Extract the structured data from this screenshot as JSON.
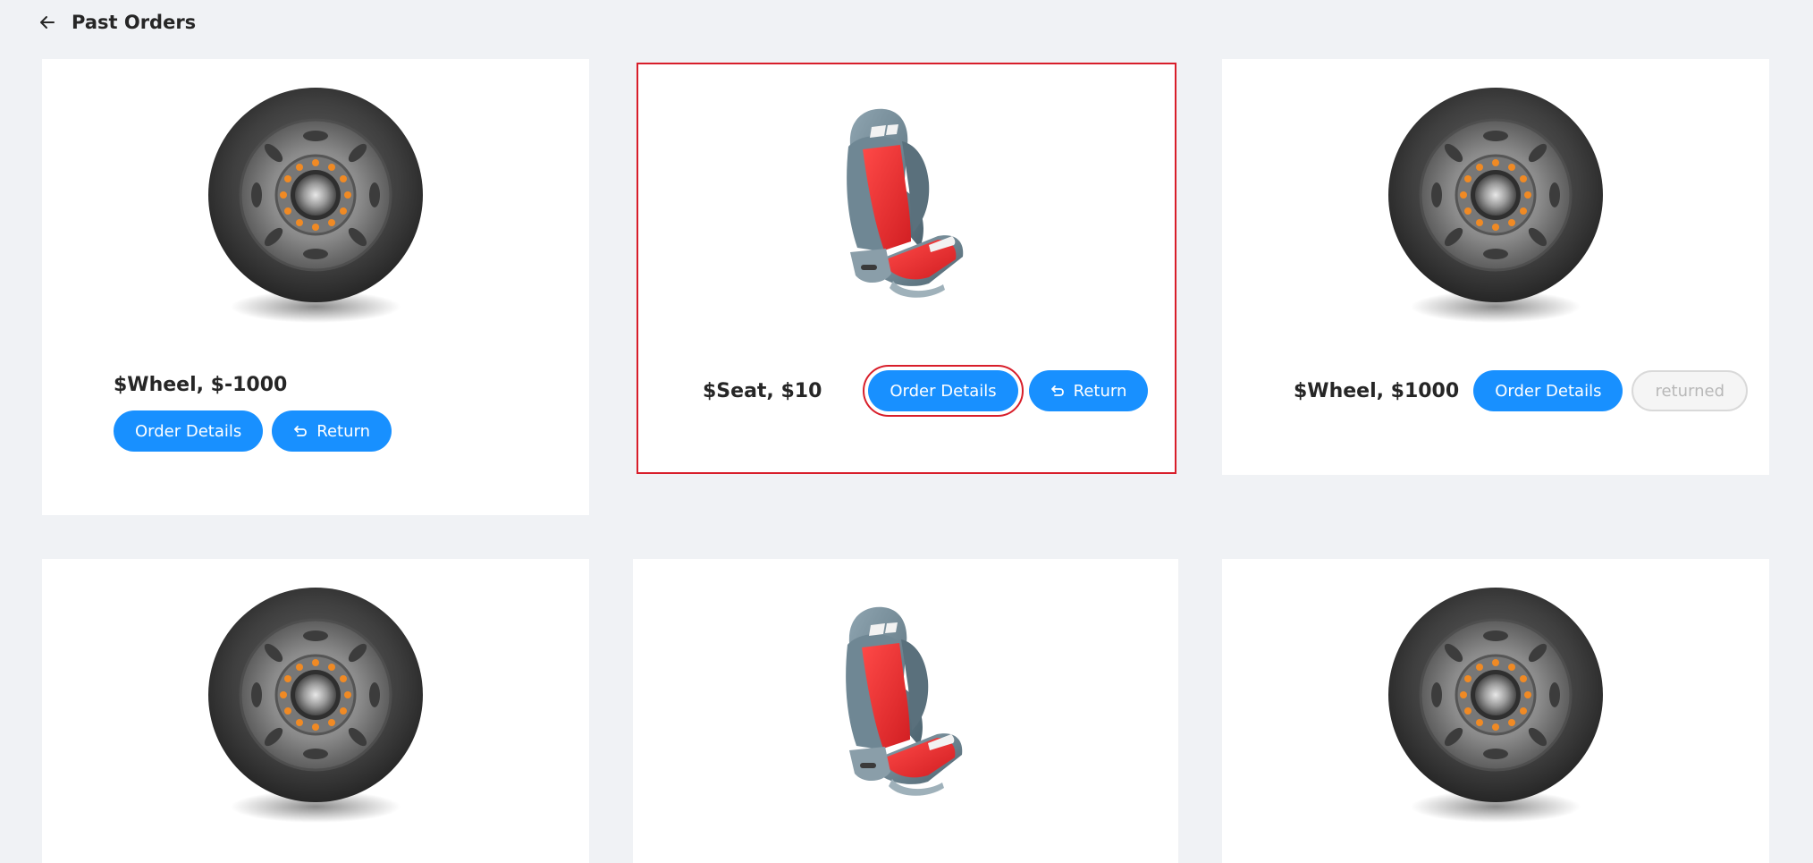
{
  "header": {
    "title": "Past Orders",
    "back_icon": "arrow-left-icon"
  },
  "colors": {
    "primary": "#1890ff",
    "highlight": "#d81e2a",
    "background": "#f0f2f5",
    "seat_red": "#e8302f"
  },
  "orders": [
    {
      "product": "wheel",
      "price_label": "$Wheel, $-1000",
      "details_label": "Order Details",
      "action_label": "Return",
      "action_state": "return"
    },
    {
      "product": "seat",
      "price_label": "$Seat, $10",
      "details_label": "Order Details",
      "action_label": "Return",
      "action_state": "return"
    },
    {
      "product": "wheel",
      "price_label": "$Wheel, $1000",
      "details_label": "Order Details",
      "action_label": "returned",
      "action_state": "returned"
    },
    {
      "product": "wheel"
    },
    {
      "product": "seat"
    },
    {
      "product": "wheel"
    }
  ]
}
